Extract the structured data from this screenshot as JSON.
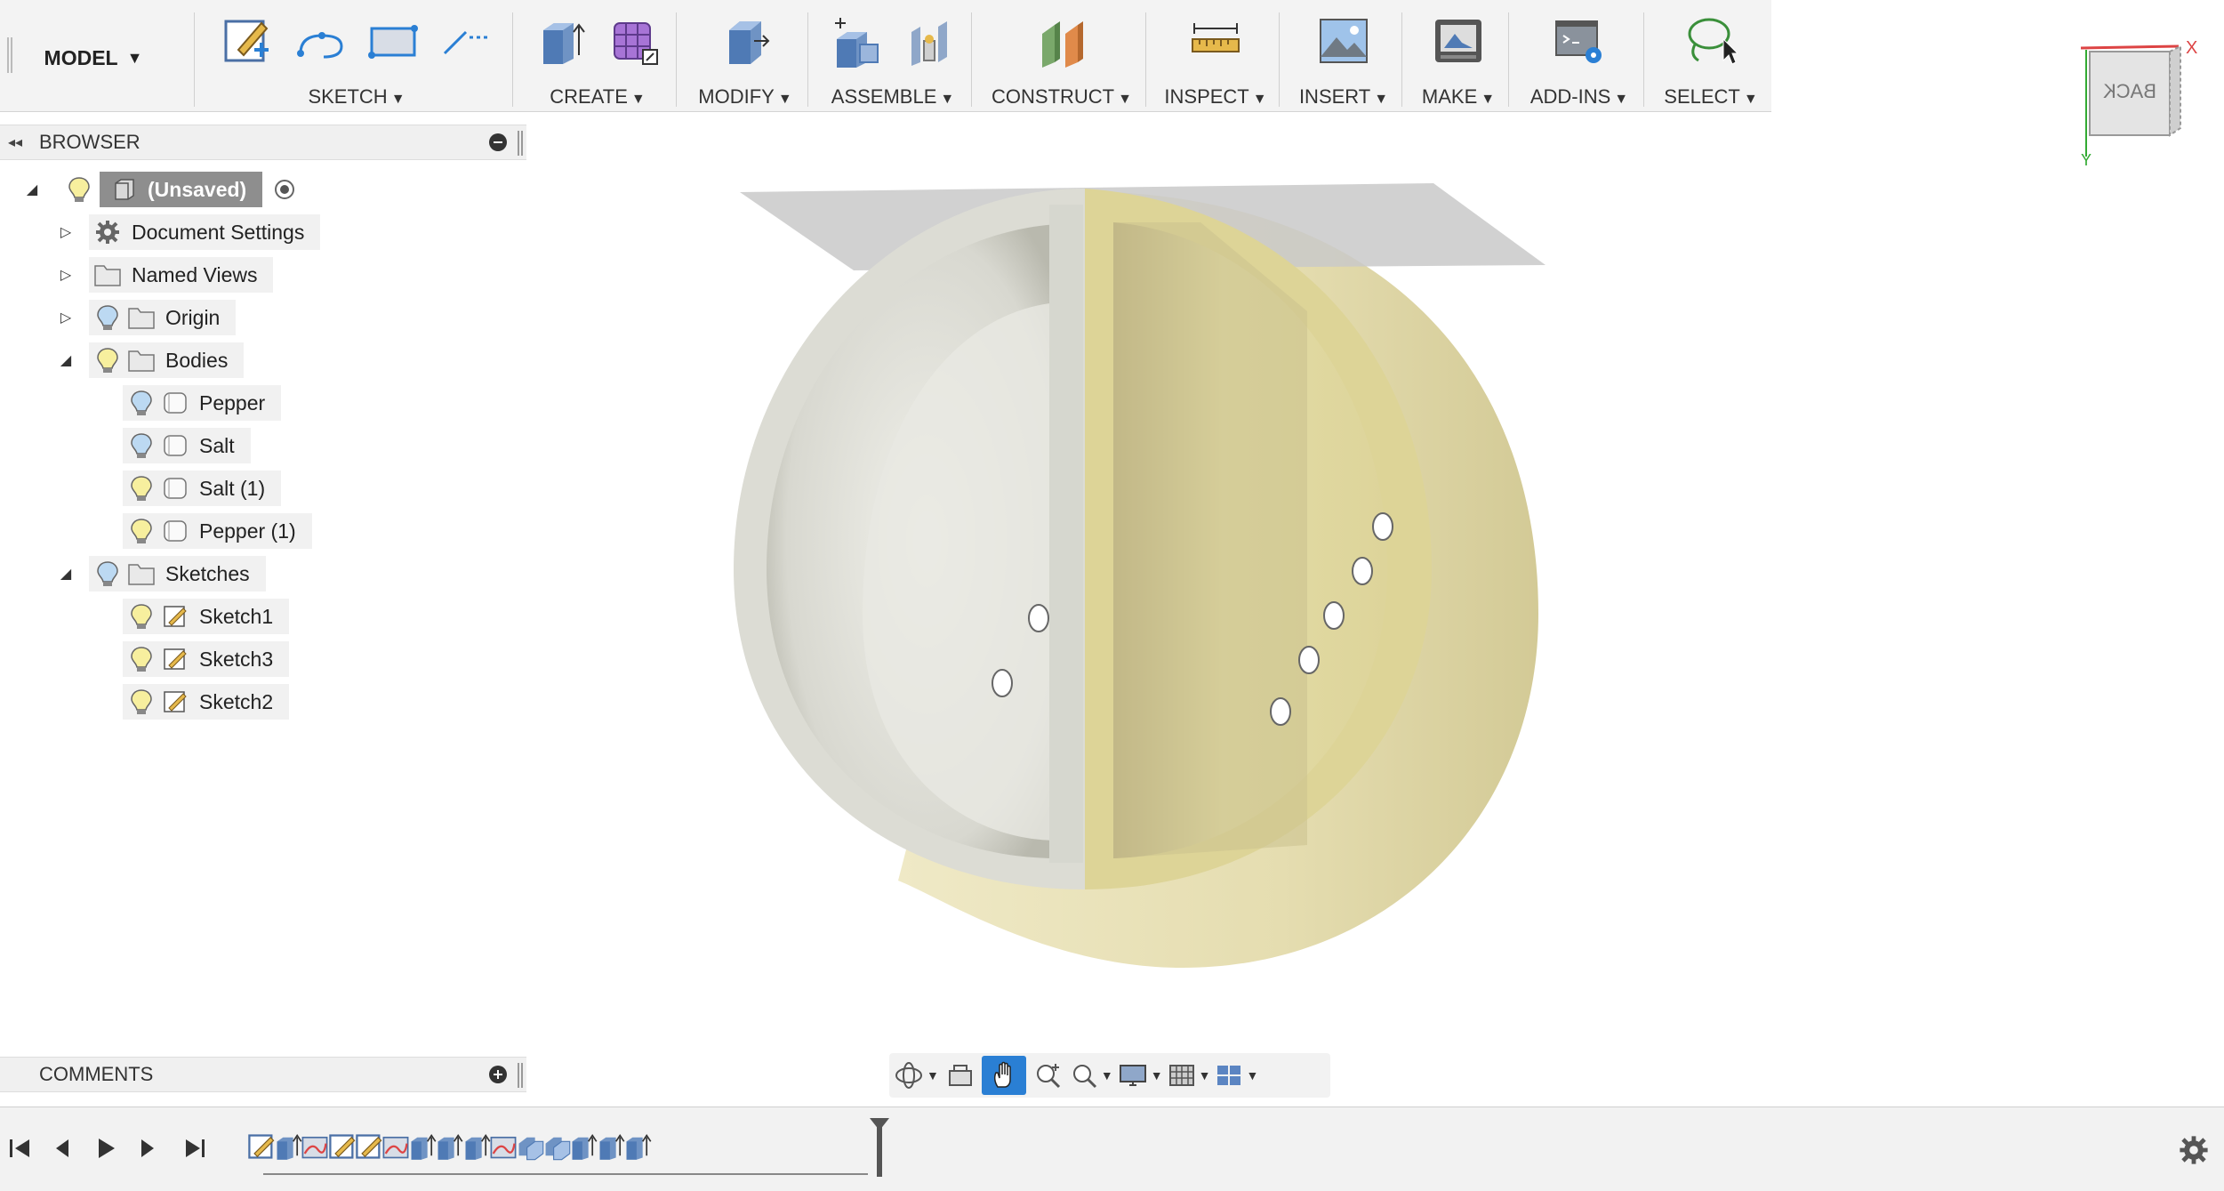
{
  "toolbar": {
    "workspace_label": "MODEL",
    "groups": [
      {
        "id": "sketch",
        "label": "SKETCH",
        "icons": [
          "create-sketch-icon",
          "arc-icon",
          "rectangle-icon",
          "line-icon"
        ]
      },
      {
        "id": "create",
        "label": "CREATE",
        "icons": [
          "extrude-icon",
          "form-icon"
        ]
      },
      {
        "id": "modify",
        "label": "MODIFY",
        "icons": [
          "press-pull-icon"
        ]
      },
      {
        "id": "assemble",
        "label": "ASSEMBLE",
        "icons": [
          "new-component-icon",
          "joint-icon"
        ]
      },
      {
        "id": "construct",
        "label": "CONSTRUCT",
        "icons": [
          "offset-plane-icon"
        ]
      },
      {
        "id": "inspect",
        "label": "INSPECT",
        "icons": [
          "measure-icon"
        ]
      },
      {
        "id": "insert",
        "label": "INSERT",
        "icons": [
          "insert-image-icon"
        ]
      },
      {
        "id": "make",
        "label": "MAKE",
        "icons": [
          "3d-print-icon"
        ]
      },
      {
        "id": "addins",
        "label": "ADD-INS",
        "icons": [
          "scripts-icon"
        ]
      },
      {
        "id": "select",
        "label": "SELECT",
        "icons": [
          "lasso-select-icon"
        ]
      }
    ]
  },
  "browser": {
    "title": "BROWSER",
    "root": {
      "label": "(Unsaved)"
    },
    "items": [
      {
        "label": "Document Settings"
      },
      {
        "label": "Named Views"
      },
      {
        "label": "Origin"
      },
      {
        "label": "Bodies"
      },
      {
        "label": "Pepper"
      },
      {
        "label": "Salt"
      },
      {
        "label": "Salt (1)"
      },
      {
        "label": "Pepper (1)"
      },
      {
        "label": "Sketches"
      },
      {
        "label": "Sketch1"
      },
      {
        "label": "Sketch3"
      },
      {
        "label": "Sketch2"
      }
    ]
  },
  "comments": {
    "title": "COMMENTS"
  },
  "viewcube": {
    "face_label": "BACK",
    "axis_x": "X",
    "axis_y": "Y"
  },
  "navbar": {
    "icons": [
      "orbit-icon",
      "look-at-icon",
      "pan-icon",
      "zoom-window-icon",
      "zoom-icon",
      "display-settings-icon",
      "grid-icon",
      "viewports-icon"
    ],
    "active": "pan-icon"
  },
  "timeline": {
    "features": [
      "sketch",
      "extrude",
      "form",
      "sketch",
      "sketch",
      "form",
      "extrude",
      "extrude",
      "extrude",
      "form",
      "combine",
      "combine",
      "extrude",
      "extrude",
      "extrude"
    ]
  },
  "colors": {
    "accent": "#2a7fd4",
    "body_grey": "#dfe0d8",
    "body_tan": "#e4dca3",
    "plane": "#c8c8c8"
  }
}
